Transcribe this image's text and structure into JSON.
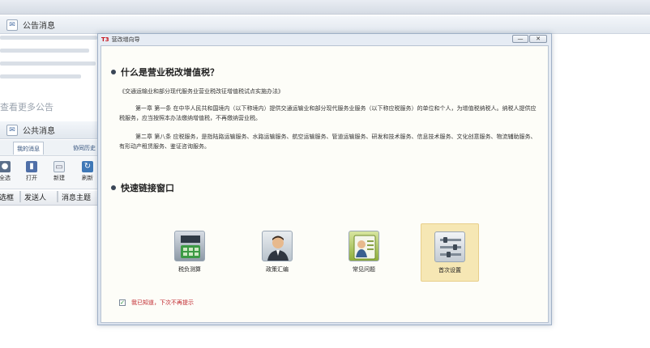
{
  "background": {
    "notice_panel": {
      "title": "公告消息",
      "more_link": "查看更多公告"
    },
    "public_panel": {
      "title": "公共消息",
      "tabs": [
        {
          "label": "我的消息"
        },
        {
          "label": "协同历史"
        }
      ],
      "toolbar": [
        {
          "label": "全选",
          "icon": "select-all-icon"
        },
        {
          "label": "打开",
          "icon": "open-icon"
        },
        {
          "label": "新建",
          "icon": "new-icon"
        },
        {
          "label": "刷新",
          "icon": "refresh-icon"
        }
      ],
      "columns": [
        {
          "label": "选框"
        },
        {
          "label": "发送人"
        },
        {
          "label": "消息主题"
        }
      ]
    }
  },
  "dialog": {
    "logo": "T3",
    "title": "营改增向导",
    "buttons": {
      "minimize": "—",
      "close": "✕"
    },
    "section1_title": "什么是营业税改增值税？",
    "law_title": "《交通运输业和部分现代服务业营业税改征增值税试点实施办法》",
    "article1": "第一章  第一条  在中华人民共和国境内（以下称境内）提供交通运输业和部分现代服务业服务（以下称应税服务）的单位和个人，为增值税纳税人。纳税人提供应税服务，应当按照本办法缴纳增值税，不再缴纳营业税。",
    "article8": "第二章  第八条  应税服务，是指陆路运输服务、水路运输服务、航空运输服务、管道运输服务、研发和技术服务、信息技术服务、文化创意服务、物流辅助服务、有形动产租赁服务、鉴证咨询服务。",
    "section2_title": "快速链接窗口",
    "quick_links": [
      {
        "label": "税负测算",
        "icon": "calculator-icon"
      },
      {
        "label": "政策汇编",
        "icon": "person-icon"
      },
      {
        "label": "常见问题",
        "icon": "faq-icon"
      },
      {
        "label": "首次设置",
        "icon": "settings-icon"
      }
    ],
    "dont_show_again": "我已知道，下次不再提示"
  }
}
